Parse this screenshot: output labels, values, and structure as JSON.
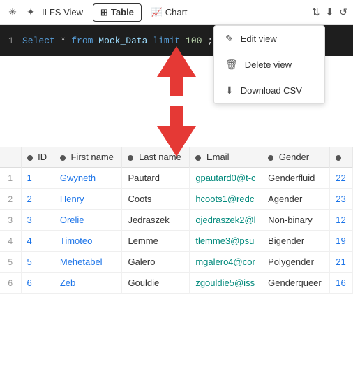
{
  "toolbar": {
    "pin_icon": "⊕",
    "star_icon": "✦",
    "title": "ILFS View",
    "table_label": "Table",
    "chart_label": "Chart",
    "filter_icon": "⇅",
    "download_icon": "↓",
    "refresh_icon": "↺"
  },
  "sql": {
    "line_num": "1",
    "query_text": "Select * from Mock_Data limit 100;"
  },
  "dropdown": {
    "items": [
      {
        "icon": "✎",
        "label": "Edit view"
      },
      {
        "icon": "🗑",
        "label": "Delete view"
      },
      {
        "icon": "↓",
        "label": "Download CSV"
      }
    ]
  },
  "table": {
    "columns": [
      {
        "label": "ID"
      },
      {
        "label": "First name"
      },
      {
        "label": "Last name"
      },
      {
        "label": "Email"
      },
      {
        "label": "Gender"
      },
      {
        "label": ""
      }
    ],
    "rows": [
      {
        "row_num": "1",
        "id": "1",
        "first_name": "Gwyneth",
        "last_name": "Pautard",
        "email": "gpautard0@t-c",
        "gender": "Genderfluid",
        "extra": "22"
      },
      {
        "row_num": "2",
        "id": "2",
        "first_name": "Henry",
        "last_name": "Coots",
        "email": "hcoots1@redc",
        "gender": "Agender",
        "extra": "23"
      },
      {
        "row_num": "3",
        "id": "3",
        "first_name": "Orelie",
        "last_name": "Jedraszek",
        "email": "ojedraszek2@l",
        "gender": "Non-binary",
        "extra": "12"
      },
      {
        "row_num": "4",
        "id": "4",
        "first_name": "Timoteo",
        "last_name": "Lemme",
        "email": "tlemme3@psu",
        "gender": "Bigender",
        "extra": "19"
      },
      {
        "row_num": "5",
        "id": "5",
        "first_name": "Mehetabel",
        "last_name": "Galero",
        "email": "mgalero4@cor",
        "gender": "Polygender",
        "extra": "21"
      },
      {
        "row_num": "6",
        "id": "6",
        "first_name": "Zeb",
        "last_name": "Gouldie",
        "email": "zgouldie5@iss",
        "gender": "Genderqueer",
        "extra": "16"
      }
    ]
  }
}
